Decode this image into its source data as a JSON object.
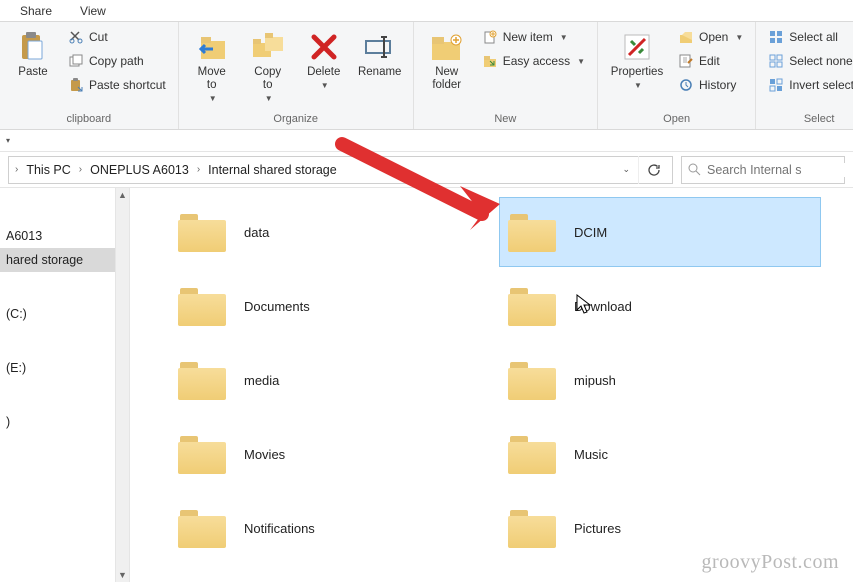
{
  "tabs": {
    "share": "Share",
    "view": "View"
  },
  "ribbon": {
    "clipboard": {
      "paste": "Paste",
      "cut": "Cut",
      "copy_path": "Copy path",
      "paste_shortcut": "Paste shortcut",
      "label": "clipboard"
    },
    "organize": {
      "move_to": "Move\nto",
      "copy_to": "Copy\nto",
      "delete": "Delete",
      "rename": "Rename",
      "label": "Organize"
    },
    "new": {
      "new_folder": "New\nfolder",
      "new_item": "New item",
      "easy_access": "Easy access",
      "label": "New"
    },
    "open": {
      "properties": "Properties",
      "open": "Open",
      "edit": "Edit",
      "history": "History",
      "label": "Open"
    },
    "select": {
      "select_all": "Select all",
      "select_none": "Select none",
      "invert": "Invert selection",
      "label": "Select"
    }
  },
  "breadcrumbs": [
    "This PC",
    "ONEPLUS A6013",
    "Internal shared storage"
  ],
  "search_placeholder": "Search Internal s",
  "sidebar": {
    "items": [
      "",
      "A6013",
      "hared storage",
      "",
      "(C:)",
      "",
      "(E:)",
      "",
      ")"
    ]
  },
  "folders": [
    {
      "name": "data"
    },
    {
      "name": "DCIM",
      "selected": true
    },
    {
      "name": "Documents"
    },
    {
      "name": "Download"
    },
    {
      "name": "media"
    },
    {
      "name": "mipush"
    },
    {
      "name": "Movies"
    },
    {
      "name": "Music"
    },
    {
      "name": "Notifications"
    },
    {
      "name": "Pictures"
    }
  ],
  "watermark": "groovyPost.com"
}
